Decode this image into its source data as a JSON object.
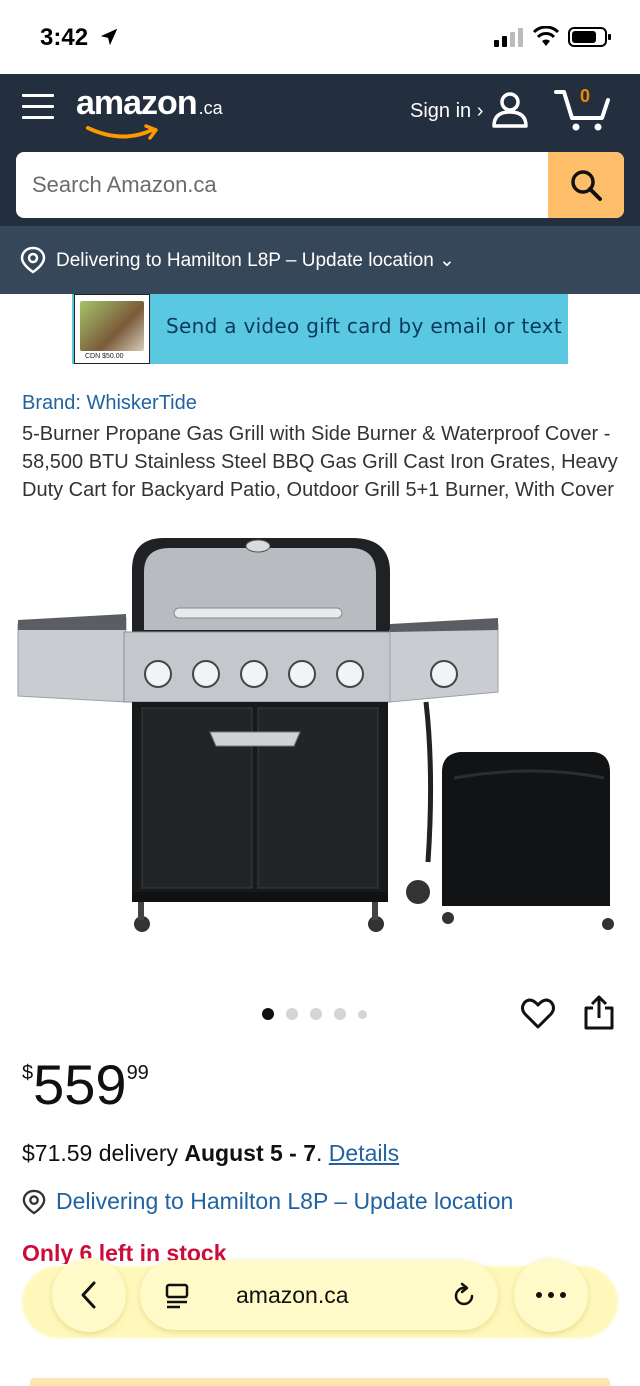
{
  "status_bar": {
    "time": "3:42"
  },
  "header": {
    "logo_text": "amazon",
    "logo_tld": ".ca",
    "sign_in": "Sign in ›",
    "cart_count": "0",
    "search_placeholder": "Search Amazon.ca",
    "delivery_location": "Delivering to Hamilton L8P – Update location ⌄"
  },
  "banner": {
    "text": "Send a video gift card by email or text",
    "card_amount": "CDN $50.00"
  },
  "product": {
    "brand": "Brand: WhiskerTide",
    "title": "5-Burner Propane Gas Grill with Side Burner & Waterproof Cover - 58,500 BTU Stainless Steel BBQ Gas Grill Cast Iron Grates, Heavy Duty Cart for Backyard Patio, Outdoor Grill 5+1 Burner, With Cover",
    "image_count": 5,
    "active_image": 1,
    "price_symbol": "$",
    "price_whole": "559",
    "price_fraction": "99",
    "delivery_fee": "$71.59 delivery ",
    "delivery_dates": "August 5 - 7",
    "delivery_period": ". ",
    "details_link": "Details",
    "delivering_to": "Delivering to Hamilton L8P – Update location",
    "stock": "Only 6 left in stock"
  },
  "safari": {
    "url": "amazon.ca"
  },
  "colors": {
    "header_bg": "#232f3e",
    "delivery_bar_bg": "#37475a",
    "search_button": "#febd69",
    "link": "#2162a1",
    "stock_red": "#cc0c39",
    "banner_bg": "#5bc8e1"
  }
}
